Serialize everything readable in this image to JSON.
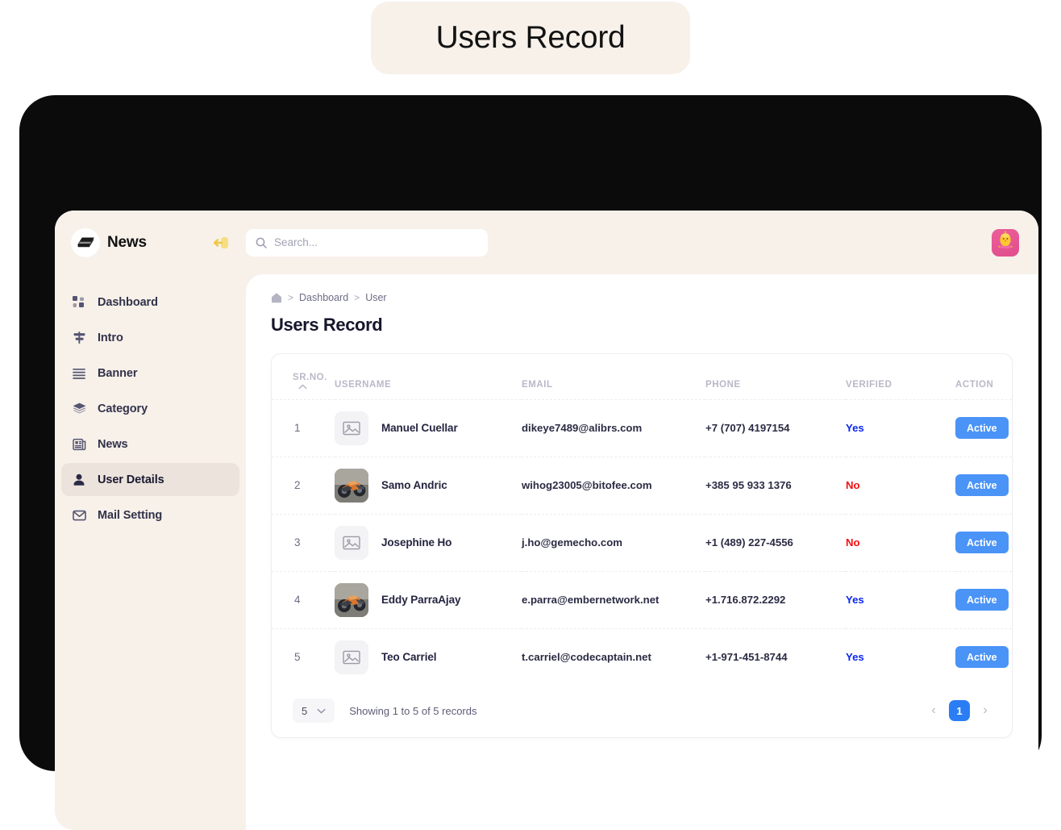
{
  "banner": {
    "title": "Users Record"
  },
  "sidebar": {
    "brand": "News",
    "collapse_icon": "collapse-arrow-icon",
    "items": [
      {
        "label": "Dashboard",
        "icon": "grid-icon",
        "active": false
      },
      {
        "label": "Intro",
        "icon": "signpost-icon",
        "active": false
      },
      {
        "label": "Banner",
        "icon": "lines-icon",
        "active": false
      },
      {
        "label": "Category",
        "icon": "layers-icon",
        "active": false
      },
      {
        "label": "News",
        "icon": "newspaper-icon",
        "active": false
      },
      {
        "label": "User Details",
        "icon": "user-icon",
        "active": true
      },
      {
        "label": "Mail Setting",
        "icon": "envelope-icon",
        "active": false
      }
    ]
  },
  "topbar": {
    "search_placeholder": "Search...",
    "search_value": "",
    "avatar_icon": "chick-avatar-icon"
  },
  "breadcrumb": {
    "home_icon": "home-icon",
    "items": [
      "Dashboard",
      "User"
    ],
    "separator": ">"
  },
  "page": {
    "title": "Users Record"
  },
  "table": {
    "headers": {
      "sr": "SR.NO.",
      "username": "USERNAME",
      "email": "EMAIL",
      "phone": "PHONE",
      "verified": "VERIFIED",
      "action": "ACTION"
    },
    "rows": [
      {
        "sr": "1",
        "username": "Manuel Cuellar",
        "email": "dikeye7489@alibrs.com",
        "phone": "+7 (707) 4197154",
        "verified": "Yes",
        "action": "Active",
        "avatar": "placeholder"
      },
      {
        "sr": "2",
        "username": "Samo Andric",
        "email": "wihog23005@bitofee.com",
        "phone": "+385 95 933 1376",
        "verified": "No",
        "action": "Active",
        "avatar": "motorcycle-photo"
      },
      {
        "sr": "3",
        "username": "Josephine Ho",
        "email": "j.ho@gemecho.com",
        "phone": "+1 (489) 227-4556",
        "verified": "No",
        "action": "Active",
        "avatar": "placeholder"
      },
      {
        "sr": "4",
        "username": "Eddy ParraAjay",
        "email": "e.parra@embernetwork.net",
        "phone": "+1.716.872.2292",
        "verified": "Yes",
        "action": "Active",
        "avatar": "motorcycle-photo"
      },
      {
        "sr": "5",
        "username": "Teo Carriel",
        "email": "t.carriel@codecaptain.net",
        "phone": "+1-971-451-8744",
        "verified": "Yes",
        "action": "Active",
        "avatar": "placeholder"
      }
    ]
  },
  "footer": {
    "per_page": "5",
    "showing": "Showing 1 to 5 of 5 records",
    "prev": "‹",
    "next": "›",
    "current_page": "1"
  },
  "colors": {
    "verified_yes": "#0b27f0",
    "verified_no": "#f41010",
    "action_button": "#4a93f7",
    "page_active": "#2a7df4",
    "sidebar_bg": "#f7f1ea",
    "accent_yellow": "#f5d76e"
  }
}
